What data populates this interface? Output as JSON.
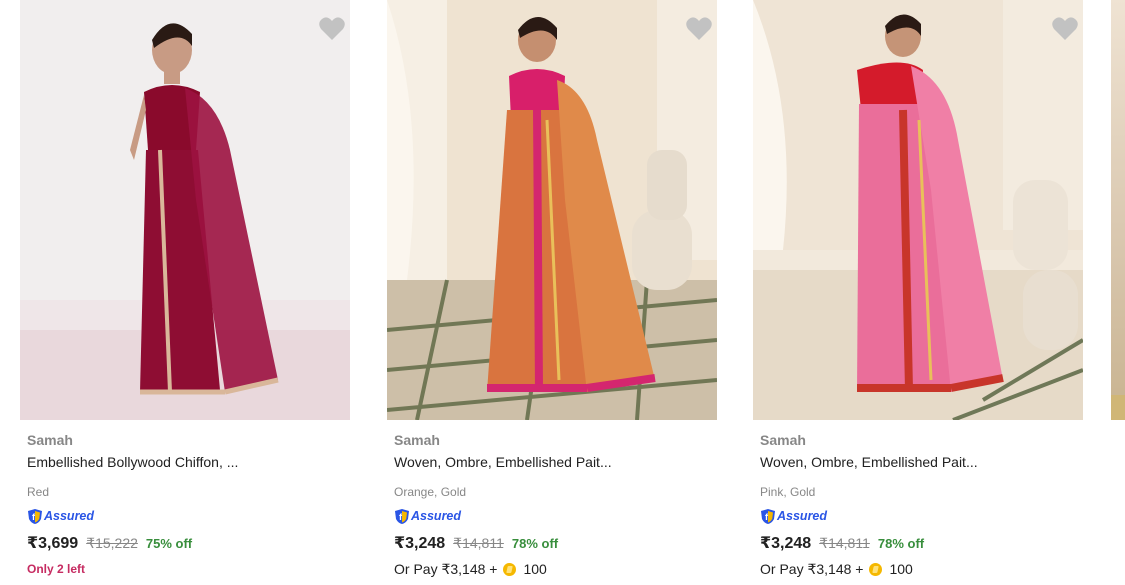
{
  "products": [
    {
      "brand": "Samah",
      "title": "Embellished Bollywood Chiffon, ...",
      "color": "Red",
      "assured": "Assured",
      "price": "₹3,699",
      "mrp": "₹15,222",
      "discount": "75% off",
      "stock_note": "Only 2 left",
      "saree_color": "#8e0d33",
      "blouse_color": "#8a0a2c",
      "border_color": "#d9b79a",
      "bg_color": "#f1eeee"
    },
    {
      "brand": "Samah",
      "title": "Woven, Ombre, Embellished Pait...",
      "color": "Orange, Gold",
      "assured": "Assured",
      "price": "₹3,248",
      "mrp": "₹14,811",
      "discount": "78% off",
      "pay_label": "Or Pay ₹3,148 +",
      "coins": "100",
      "saree_color": "#d9743f",
      "blouse_color": "#d81f6a",
      "border_color": "#d4266f",
      "bg_color": "#efe3d1"
    },
    {
      "brand": "Samah",
      "title": "Woven, Ombre, Embellished Pait...",
      "color": "Pink, Gold",
      "assured": "Assured",
      "price": "₹3,248",
      "mrp": "₹14,811",
      "discount": "78% off",
      "pay_label": "Or Pay ₹3,148 +",
      "coins": "100",
      "saree_color": "#ea6e9a",
      "blouse_color": "#d41b2b",
      "border_color": "#c8352a",
      "bg_color": "#efe4d5"
    }
  ],
  "colors": {
    "price_green": "#388e3c",
    "stock_red": "#c62b61",
    "assured_blue": "#2a55e5",
    "muted_text": "#878787"
  }
}
